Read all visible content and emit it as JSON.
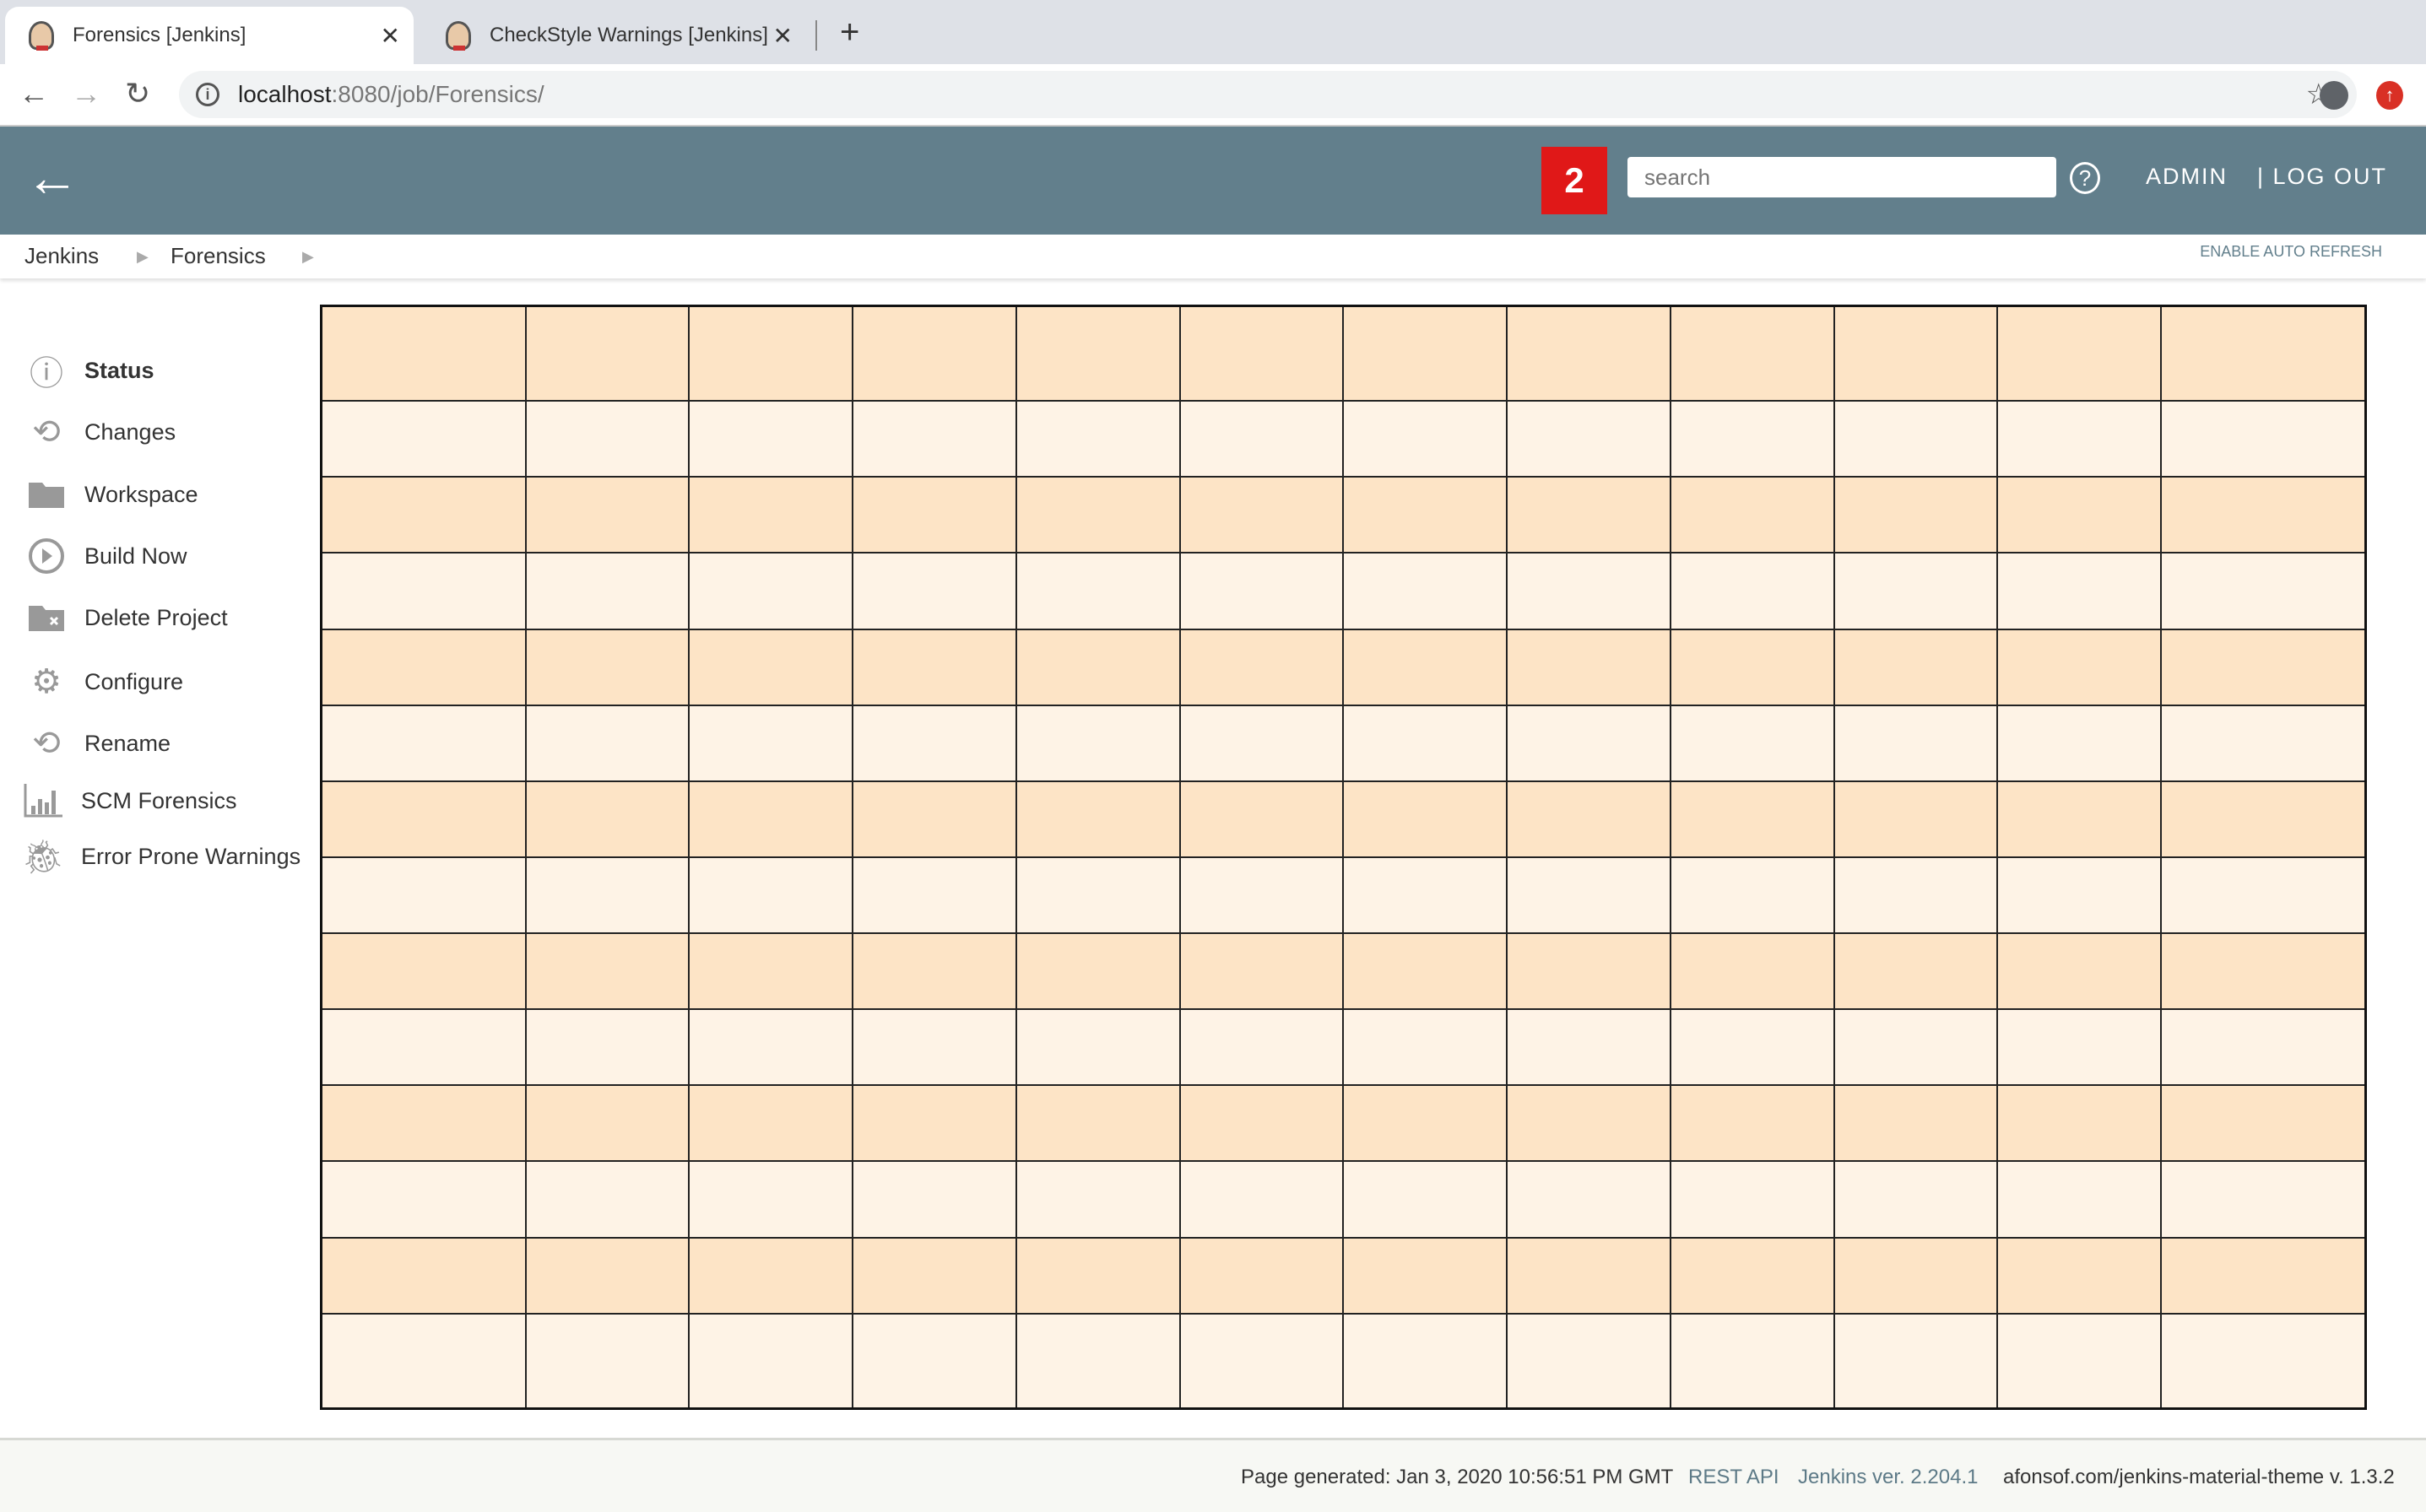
{
  "browser": {
    "tabs": [
      {
        "title": "Forensics [Jenkins]",
        "active": true
      },
      {
        "title": "CheckStyle Warnings [Jenkins]",
        "active": false
      }
    ],
    "url_host": "localhost",
    "url_path": ":8080/job/Forensics/"
  },
  "header": {
    "badge": "2",
    "search_placeholder": "search",
    "admin": "ADMIN",
    "logout": "| LOG OUT",
    "color": "#627f8c",
    "badge_color": "#e01818"
  },
  "breadcrumb": {
    "items": [
      "Jenkins",
      "Forensics"
    ],
    "auto_refresh": "ENABLE AUTO REFRESH"
  },
  "sidebar": {
    "items": [
      {
        "label": "Status",
        "icon": "info-icon",
        "bold": true
      },
      {
        "label": "Changes",
        "icon": "history-icon"
      },
      {
        "label": "Workspace",
        "icon": "folder-icon"
      },
      {
        "label": "Build Now",
        "icon": "play-icon"
      },
      {
        "label": "Delete Project",
        "icon": "folder-delete-icon"
      },
      {
        "label": "Configure",
        "icon": "gear-icon"
      },
      {
        "label": "Rename",
        "icon": "history-icon"
      },
      {
        "label": "SCM Forensics",
        "icon": "bar-chart-icon"
      },
      {
        "label": "Error Prone Warnings",
        "icon": "bug-icon"
      }
    ]
  },
  "table": {
    "row_colors": [
      "#fde4c6",
      "#fef3e6"
    ],
    "rows": [
      [
        "",
        "",
        "",
        "",
        "",
        "",
        "",
        "",
        "",
        "",
        "",
        ""
      ],
      [
        "",
        "",
        "",
        "",
        "",
        "",
        "",
        "",
        "",
        "",
        "",
        ""
      ],
      [
        "",
        "",
        "",
        "",
        "",
        "",
        "",
        "",
        "",
        "",
        "",
        ""
      ],
      [
        "",
        "",
        "",
        "",
        "",
        "",
        "",
        "",
        "",
        "",
        "",
        ""
      ],
      [
        "",
        "",
        "",
        "",
        "",
        "",
        "",
        "",
        "",
        "",
        "",
        ""
      ],
      [
        "",
        "",
        "",
        "",
        "",
        "",
        "",
        "",
        "",
        "",
        "",
        ""
      ],
      [
        "",
        "",
        "",
        "",
        "",
        "",
        "",
        "",
        "",
        "",
        "",
        ""
      ],
      [
        "",
        "",
        "",
        "",
        "",
        "",
        "",
        "",
        "",
        "",
        "",
        ""
      ],
      [
        "",
        "",
        "",
        "",
        "",
        "",
        "",
        "",
        "",
        "",
        "",
        ""
      ],
      [
        "",
        "",
        "",
        "",
        "",
        "",
        "",
        "",
        "",
        "",
        "",
        ""
      ],
      [
        "",
        "",
        "",
        "",
        "",
        "",
        "",
        "",
        "",
        "",
        "",
        ""
      ],
      [
        "",
        "",
        "",
        "",
        "",
        "",
        "",
        "",
        "",
        "",
        "",
        ""
      ],
      [
        "",
        "",
        "",
        "",
        "",
        "",
        "",
        "",
        "",
        "",
        "",
        ""
      ],
      [
        "",
        "",
        "",
        "",
        "",
        "",
        "",
        "",
        "",
        "",
        "",
        ""
      ]
    ]
  },
  "footer": {
    "generated": "Page generated: Jan 3, 2020 10:56:51 PM GMT",
    "rest_api": "REST API",
    "version": "Jenkins ver. 2.204.1",
    "theme": "afonsof.com/jenkins-material-theme v. 1.3.2"
  }
}
